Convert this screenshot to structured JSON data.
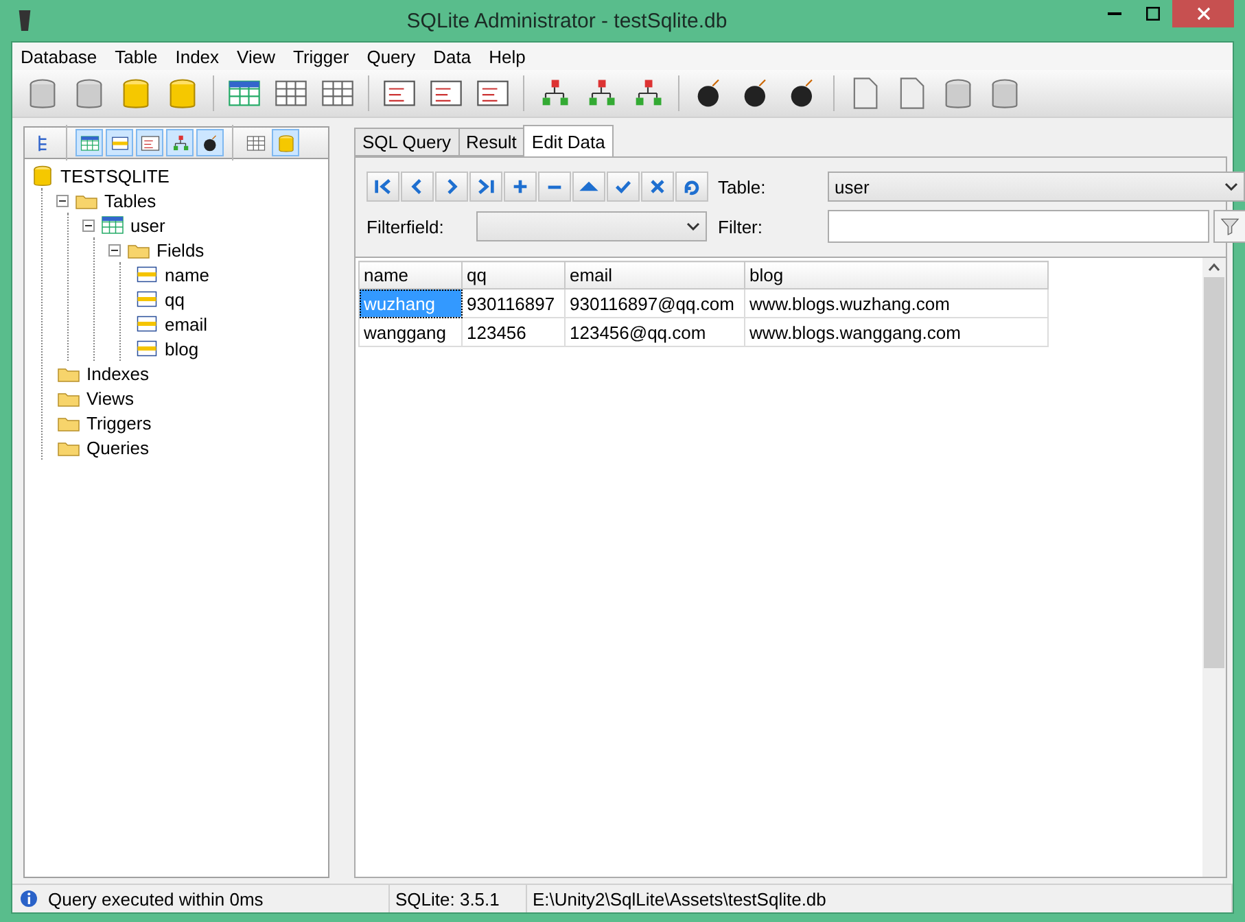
{
  "window": {
    "title": "SQLite Administrator - testSqlite.db"
  },
  "menu": [
    "Database",
    "Table",
    "Index",
    "View",
    "Trigger",
    "Query",
    "Data",
    "Help"
  ],
  "left_toolbar": [
    {
      "selected": false
    },
    {
      "selected": true
    },
    {
      "selected": true
    },
    {
      "selected": true
    },
    {
      "selected": true
    },
    {
      "selected": true
    },
    {
      "selected": false
    },
    {
      "selected": true
    }
  ],
  "tree": [
    {
      "label": "TESTSQLITE",
      "kind": "database",
      "children": [
        {
          "label": "Tables",
          "kind": "folder",
          "expanded": true,
          "children": [
            {
              "label": "user",
              "kind": "table",
              "expanded": true,
              "children": [
                {
                  "label": "Fields",
                  "kind": "folder",
                  "expanded": true,
                  "children": [
                    {
                      "label": "name",
                      "kind": "field"
                    },
                    {
                      "label": "qq",
                      "kind": "field"
                    },
                    {
                      "label": "email",
                      "kind": "field"
                    },
                    {
                      "label": "blog",
                      "kind": "field"
                    }
                  ]
                }
              ]
            }
          ]
        },
        {
          "label": "Indexes",
          "kind": "folder"
        },
        {
          "label": "Views",
          "kind": "folder"
        },
        {
          "label": "Triggers",
          "kind": "folder"
        },
        {
          "label": "Queries",
          "kind": "folder"
        }
      ]
    }
  ],
  "tabs": [
    {
      "label": "SQL Query",
      "selected": false
    },
    {
      "label": "Result",
      "selected": false
    },
    {
      "label": "Edit Data",
      "selected": true
    }
  ],
  "table_select": {
    "label": "Table:",
    "value": "user"
  },
  "filterfield": {
    "label": "Filterfield:"
  },
  "filter": {
    "label": "Filter:"
  },
  "grid": {
    "columns": [
      "name",
      "qq",
      "email",
      "blog"
    ],
    "rows": [
      {
        "cells": [
          {
            "text": "wuzhang",
            "selected": true
          },
          {
            "text": "930116897",
            "selected": false
          },
          {
            "text": "930116897@qq.com",
            "selected": false
          },
          {
            "text": "www.blogs.wuzhang.com",
            "selected": false
          }
        ]
      },
      {
        "cells": [
          {
            "text": "wanggang",
            "selected": false
          },
          {
            "text": "123456",
            "selected": false
          },
          {
            "text": "123456@qq.com",
            "selected": false
          },
          {
            "text": "www.blogs.wanggang.com",
            "selected": false
          }
        ]
      }
    ]
  },
  "status_bar": [
    "Query executed within 0ms",
    "SQLite: 3.5.1",
    "E:\\Unity2\\SqlLite\\Assets\\testSqlite.db"
  ]
}
